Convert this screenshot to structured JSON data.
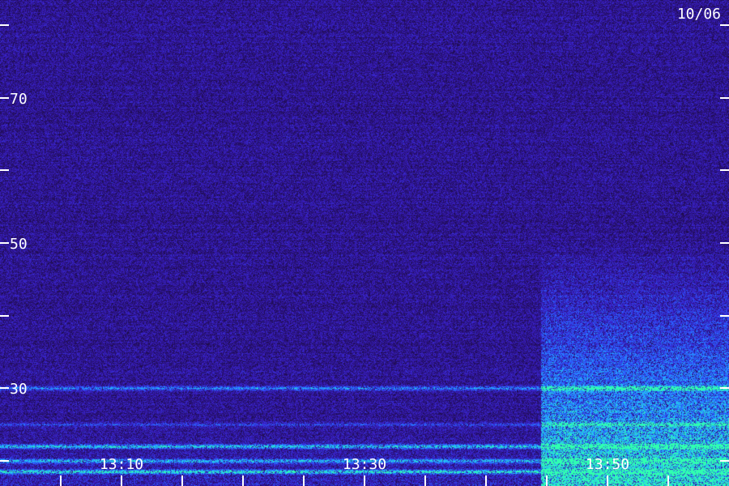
{
  "chart_data": {
    "type": "heatmap",
    "title": "",
    "date_label": "10/06",
    "y_ticks_major": [
      {
        "value": 30,
        "label": "30"
      },
      {
        "value": 50,
        "label": "50"
      },
      {
        "value": 70,
        "label": "70"
      }
    ],
    "y_ticks_minor": [
      20,
      40,
      60,
      80
    ],
    "y_range": [
      16.5,
      83.5
    ],
    "x_ticks_major": [
      {
        "minutes": 10,
        "label": "13:10"
      },
      {
        "minutes": 30,
        "label": "13:30"
      },
      {
        "minutes": 50,
        "label": "13:50"
      }
    ],
    "x_ticks_minor_minutes": [
      5,
      15,
      20,
      25,
      35,
      40,
      45,
      55
    ],
    "x_range_minutes": [
      0,
      60
    ],
    "colormap": [
      "#1a0a33",
      "#2a1280",
      "#3a20c8",
      "#2a5cff",
      "#22b8ff",
      "#30ffb0"
    ],
    "features": [
      {
        "name": "band",
        "value": 30,
        "intensity": 0.6
      },
      {
        "name": "band",
        "value": 25,
        "intensity": 0.35
      },
      {
        "name": "band",
        "value": 22,
        "intensity": 0.85
      },
      {
        "name": "band",
        "value": 20,
        "intensity": 0.7
      },
      {
        "name": "band",
        "value": 18.5,
        "intensity": 0.9
      },
      {
        "name": "activity_onset_minutes",
        "value": 44.5
      }
    ]
  }
}
